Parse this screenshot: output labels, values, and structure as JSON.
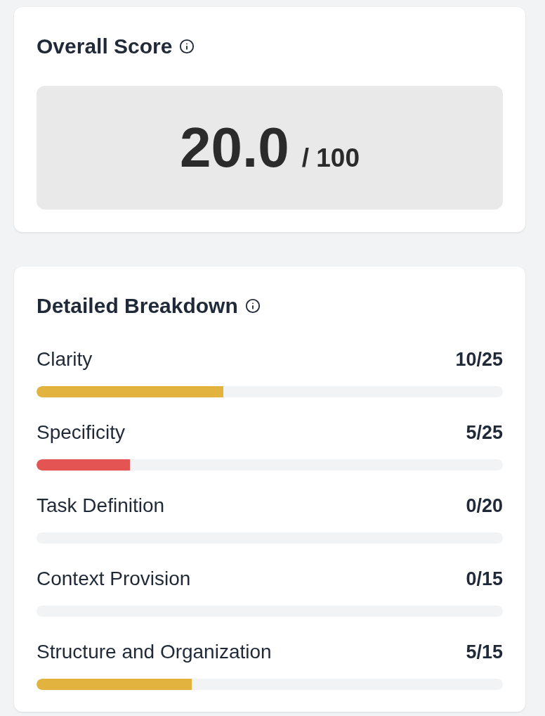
{
  "overall_score": {
    "title": "Overall Score",
    "score": "20.0",
    "max": "/ 100"
  },
  "breakdown": {
    "title": "Detailed Breakdown",
    "items": [
      {
        "label": "Clarity",
        "value": "10/25",
        "level": 0.4,
        "color": "#e2b33e"
      },
      {
        "label": "Specificity",
        "value": "5/25",
        "level": 0.2,
        "color": "#e35452"
      },
      {
        "label": "Task Definition",
        "value": "0/20"
      },
      {
        "label": "Context Provision",
        "value": "0/15"
      },
      {
        "label": "Structure and Organization",
        "value": "5/15",
        "level": 0.333,
        "color": "#e2b33e"
      }
    ]
  }
}
